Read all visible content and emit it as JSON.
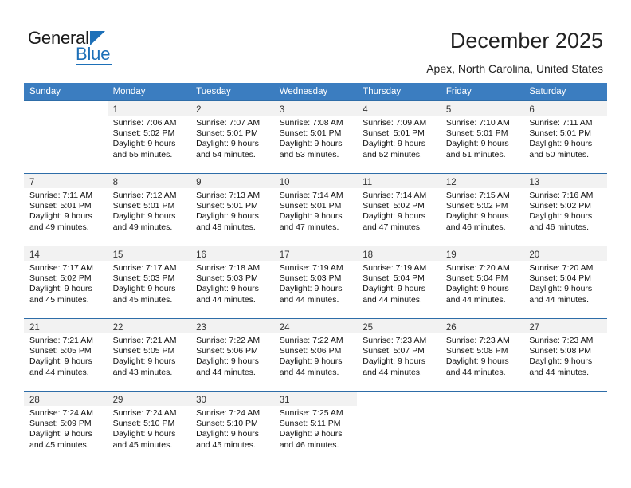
{
  "brand": {
    "name_top": "General",
    "name_bottom": "Blue",
    "accent_color": "#1d70b8"
  },
  "header": {
    "title": "December 2025",
    "subtitle": "Apex, North Carolina, United States"
  },
  "theme": {
    "header_bg": "#3b7dc0",
    "header_text": "#ffffff",
    "daynum_band_bg": "#f2f2f2",
    "row_border": "#2e6da8",
    "body_text": "#111111"
  },
  "calendar": {
    "weekday_headers": [
      "Sunday",
      "Monday",
      "Tuesday",
      "Wednesday",
      "Thursday",
      "Friday",
      "Saturday"
    ],
    "weeks": [
      [
        {
          "day": "",
          "sunrise": "",
          "sunset": "",
          "daylight_line1": "",
          "daylight_line2": ""
        },
        {
          "day": "1",
          "sunrise": "Sunrise: 7:06 AM",
          "sunset": "Sunset: 5:02 PM",
          "daylight_line1": "Daylight: 9 hours",
          "daylight_line2": "and 55 minutes."
        },
        {
          "day": "2",
          "sunrise": "Sunrise: 7:07 AM",
          "sunset": "Sunset: 5:01 PM",
          "daylight_line1": "Daylight: 9 hours",
          "daylight_line2": "and 54 minutes."
        },
        {
          "day": "3",
          "sunrise": "Sunrise: 7:08 AM",
          "sunset": "Sunset: 5:01 PM",
          "daylight_line1": "Daylight: 9 hours",
          "daylight_line2": "and 53 minutes."
        },
        {
          "day": "4",
          "sunrise": "Sunrise: 7:09 AM",
          "sunset": "Sunset: 5:01 PM",
          "daylight_line1": "Daylight: 9 hours",
          "daylight_line2": "and 52 minutes."
        },
        {
          "day": "5",
          "sunrise": "Sunrise: 7:10 AM",
          "sunset": "Sunset: 5:01 PM",
          "daylight_line1": "Daylight: 9 hours",
          "daylight_line2": "and 51 minutes."
        },
        {
          "day": "6",
          "sunrise": "Sunrise: 7:11 AM",
          "sunset": "Sunset: 5:01 PM",
          "daylight_line1": "Daylight: 9 hours",
          "daylight_line2": "and 50 minutes."
        }
      ],
      [
        {
          "day": "7",
          "sunrise": "Sunrise: 7:11 AM",
          "sunset": "Sunset: 5:01 PM",
          "daylight_line1": "Daylight: 9 hours",
          "daylight_line2": "and 49 minutes."
        },
        {
          "day": "8",
          "sunrise": "Sunrise: 7:12 AM",
          "sunset": "Sunset: 5:01 PM",
          "daylight_line1": "Daylight: 9 hours",
          "daylight_line2": "and 49 minutes."
        },
        {
          "day": "9",
          "sunrise": "Sunrise: 7:13 AM",
          "sunset": "Sunset: 5:01 PM",
          "daylight_line1": "Daylight: 9 hours",
          "daylight_line2": "and 48 minutes."
        },
        {
          "day": "10",
          "sunrise": "Sunrise: 7:14 AM",
          "sunset": "Sunset: 5:01 PM",
          "daylight_line1": "Daylight: 9 hours",
          "daylight_line2": "and 47 minutes."
        },
        {
          "day": "11",
          "sunrise": "Sunrise: 7:14 AM",
          "sunset": "Sunset: 5:02 PM",
          "daylight_line1": "Daylight: 9 hours",
          "daylight_line2": "and 47 minutes."
        },
        {
          "day": "12",
          "sunrise": "Sunrise: 7:15 AM",
          "sunset": "Sunset: 5:02 PM",
          "daylight_line1": "Daylight: 9 hours",
          "daylight_line2": "and 46 minutes."
        },
        {
          "day": "13",
          "sunrise": "Sunrise: 7:16 AM",
          "sunset": "Sunset: 5:02 PM",
          "daylight_line1": "Daylight: 9 hours",
          "daylight_line2": "and 46 minutes."
        }
      ],
      [
        {
          "day": "14",
          "sunrise": "Sunrise: 7:17 AM",
          "sunset": "Sunset: 5:02 PM",
          "daylight_line1": "Daylight: 9 hours",
          "daylight_line2": "and 45 minutes."
        },
        {
          "day": "15",
          "sunrise": "Sunrise: 7:17 AM",
          "sunset": "Sunset: 5:03 PM",
          "daylight_line1": "Daylight: 9 hours",
          "daylight_line2": "and 45 minutes."
        },
        {
          "day": "16",
          "sunrise": "Sunrise: 7:18 AM",
          "sunset": "Sunset: 5:03 PM",
          "daylight_line1": "Daylight: 9 hours",
          "daylight_line2": "and 44 minutes."
        },
        {
          "day": "17",
          "sunrise": "Sunrise: 7:19 AM",
          "sunset": "Sunset: 5:03 PM",
          "daylight_line1": "Daylight: 9 hours",
          "daylight_line2": "and 44 minutes."
        },
        {
          "day": "18",
          "sunrise": "Sunrise: 7:19 AM",
          "sunset": "Sunset: 5:04 PM",
          "daylight_line1": "Daylight: 9 hours",
          "daylight_line2": "and 44 minutes."
        },
        {
          "day": "19",
          "sunrise": "Sunrise: 7:20 AM",
          "sunset": "Sunset: 5:04 PM",
          "daylight_line1": "Daylight: 9 hours",
          "daylight_line2": "and 44 minutes."
        },
        {
          "day": "20",
          "sunrise": "Sunrise: 7:20 AM",
          "sunset": "Sunset: 5:04 PM",
          "daylight_line1": "Daylight: 9 hours",
          "daylight_line2": "and 44 minutes."
        }
      ],
      [
        {
          "day": "21",
          "sunrise": "Sunrise: 7:21 AM",
          "sunset": "Sunset: 5:05 PM",
          "daylight_line1": "Daylight: 9 hours",
          "daylight_line2": "and 44 minutes."
        },
        {
          "day": "22",
          "sunrise": "Sunrise: 7:21 AM",
          "sunset": "Sunset: 5:05 PM",
          "daylight_line1": "Daylight: 9 hours",
          "daylight_line2": "and 43 minutes."
        },
        {
          "day": "23",
          "sunrise": "Sunrise: 7:22 AM",
          "sunset": "Sunset: 5:06 PM",
          "daylight_line1": "Daylight: 9 hours",
          "daylight_line2": "and 44 minutes."
        },
        {
          "day": "24",
          "sunrise": "Sunrise: 7:22 AM",
          "sunset": "Sunset: 5:06 PM",
          "daylight_line1": "Daylight: 9 hours",
          "daylight_line2": "and 44 minutes."
        },
        {
          "day": "25",
          "sunrise": "Sunrise: 7:23 AM",
          "sunset": "Sunset: 5:07 PM",
          "daylight_line1": "Daylight: 9 hours",
          "daylight_line2": "and 44 minutes."
        },
        {
          "day": "26",
          "sunrise": "Sunrise: 7:23 AM",
          "sunset": "Sunset: 5:08 PM",
          "daylight_line1": "Daylight: 9 hours",
          "daylight_line2": "and 44 minutes."
        },
        {
          "day": "27",
          "sunrise": "Sunrise: 7:23 AM",
          "sunset": "Sunset: 5:08 PM",
          "daylight_line1": "Daylight: 9 hours",
          "daylight_line2": "and 44 minutes."
        }
      ],
      [
        {
          "day": "28",
          "sunrise": "Sunrise: 7:24 AM",
          "sunset": "Sunset: 5:09 PM",
          "daylight_line1": "Daylight: 9 hours",
          "daylight_line2": "and 45 minutes."
        },
        {
          "day": "29",
          "sunrise": "Sunrise: 7:24 AM",
          "sunset": "Sunset: 5:10 PM",
          "daylight_line1": "Daylight: 9 hours",
          "daylight_line2": "and 45 minutes."
        },
        {
          "day": "30",
          "sunrise": "Sunrise: 7:24 AM",
          "sunset": "Sunset: 5:10 PM",
          "daylight_line1": "Daylight: 9 hours",
          "daylight_line2": "and 45 minutes."
        },
        {
          "day": "31",
          "sunrise": "Sunrise: 7:25 AM",
          "sunset": "Sunset: 5:11 PM",
          "daylight_line1": "Daylight: 9 hours",
          "daylight_line2": "and 46 minutes."
        },
        {
          "day": "",
          "sunrise": "",
          "sunset": "",
          "daylight_line1": "",
          "daylight_line2": ""
        },
        {
          "day": "",
          "sunrise": "",
          "sunset": "",
          "daylight_line1": "",
          "daylight_line2": ""
        },
        {
          "day": "",
          "sunrise": "",
          "sunset": "",
          "daylight_line1": "",
          "daylight_line2": ""
        }
      ]
    ]
  }
}
